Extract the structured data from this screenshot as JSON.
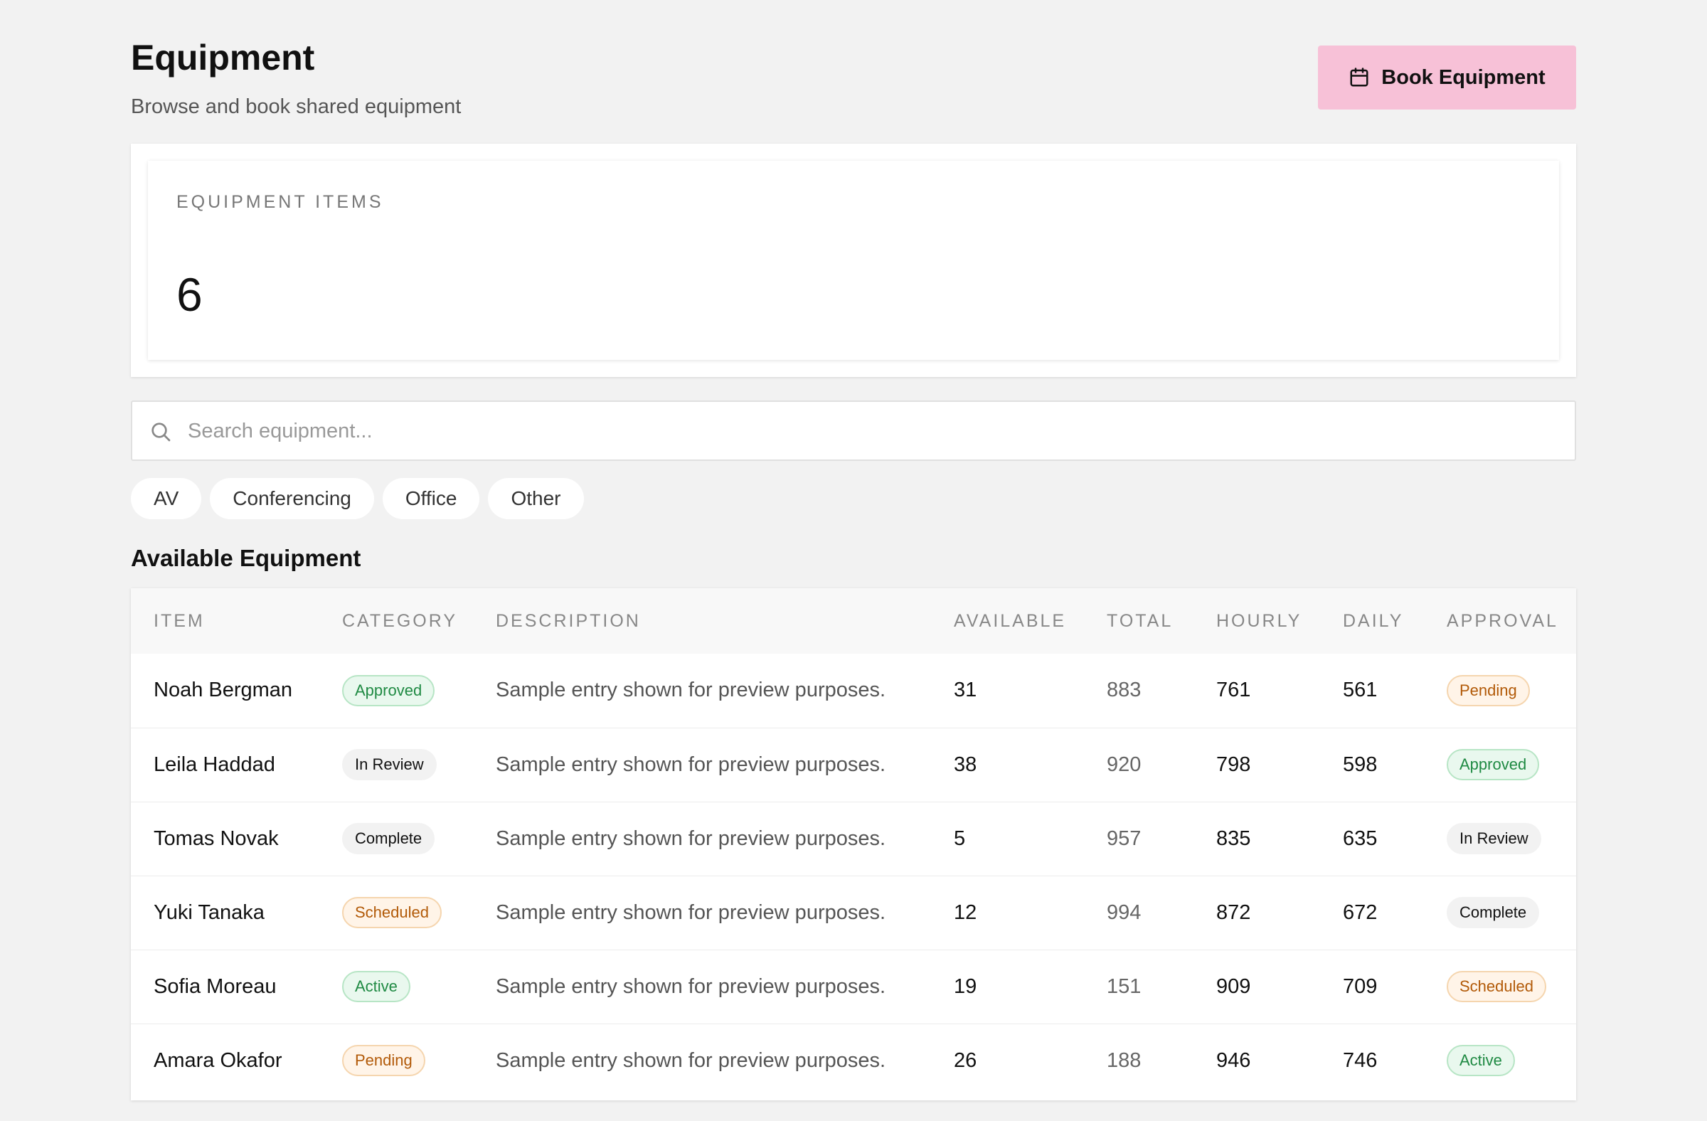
{
  "header": {
    "title": "Equipment",
    "subtitle": "Browse and book shared equipment",
    "book_button_label": "Book Equipment"
  },
  "stats": {
    "label": "EQUIPMENT ITEMS",
    "value": "6"
  },
  "search": {
    "placeholder": "Search equipment..."
  },
  "filters": [
    "AV",
    "Conferencing",
    "Office",
    "Other"
  ],
  "section": {
    "title": "Available Equipment"
  },
  "table": {
    "columns": [
      "ITEM",
      "CATEGORY",
      "DESCRIPTION",
      "AVAILABLE",
      "TOTAL",
      "HOURLY",
      "DAILY",
      "APPROVAL"
    ],
    "rows": [
      {
        "item": "Noah Bergman",
        "category": "Approved",
        "category_style": "green",
        "description": "Sample entry shown for preview purposes.",
        "available": "31",
        "total": "883",
        "hourly": "761",
        "daily": "561",
        "approval": "Pending",
        "approval_style": "orange"
      },
      {
        "item": "Leila Haddad",
        "category": "In Review",
        "category_style": "gray",
        "description": "Sample entry shown for preview purposes.",
        "available": "38",
        "total": "920",
        "hourly": "798",
        "daily": "598",
        "approval": "Approved",
        "approval_style": "green"
      },
      {
        "item": "Tomas Novak",
        "category": "Complete",
        "category_style": "gray",
        "description": "Sample entry shown for preview purposes.",
        "available": "5",
        "total": "957",
        "hourly": "835",
        "daily": "635",
        "approval": "In Review",
        "approval_style": "gray"
      },
      {
        "item": "Yuki Tanaka",
        "category": "Scheduled",
        "category_style": "orange",
        "description": "Sample entry shown for preview purposes.",
        "available": "12",
        "total": "994",
        "hourly": "872",
        "daily": "672",
        "approval": "Complete",
        "approval_style": "gray"
      },
      {
        "item": "Sofia Moreau",
        "category": "Active",
        "category_style": "green",
        "description": "Sample entry shown for preview purposes.",
        "available": "19",
        "total": "151",
        "hourly": "909",
        "daily": "709",
        "approval": "Scheduled",
        "approval_style": "orange"
      },
      {
        "item": "Amara Okafor",
        "category": "Pending",
        "category_style": "orange",
        "description": "Sample entry shown for preview purposes.",
        "available": "26",
        "total": "188",
        "hourly": "946",
        "daily": "746",
        "approval": "Active",
        "approval_style": "green"
      }
    ]
  },
  "colors": {
    "background": "#f2f2f2",
    "accent_button": "#f7c1d7",
    "badge_green": "#1f8a43",
    "badge_orange": "#b25a08"
  },
  "icons": {
    "book_button": "calendar-icon",
    "search": "search-icon"
  }
}
